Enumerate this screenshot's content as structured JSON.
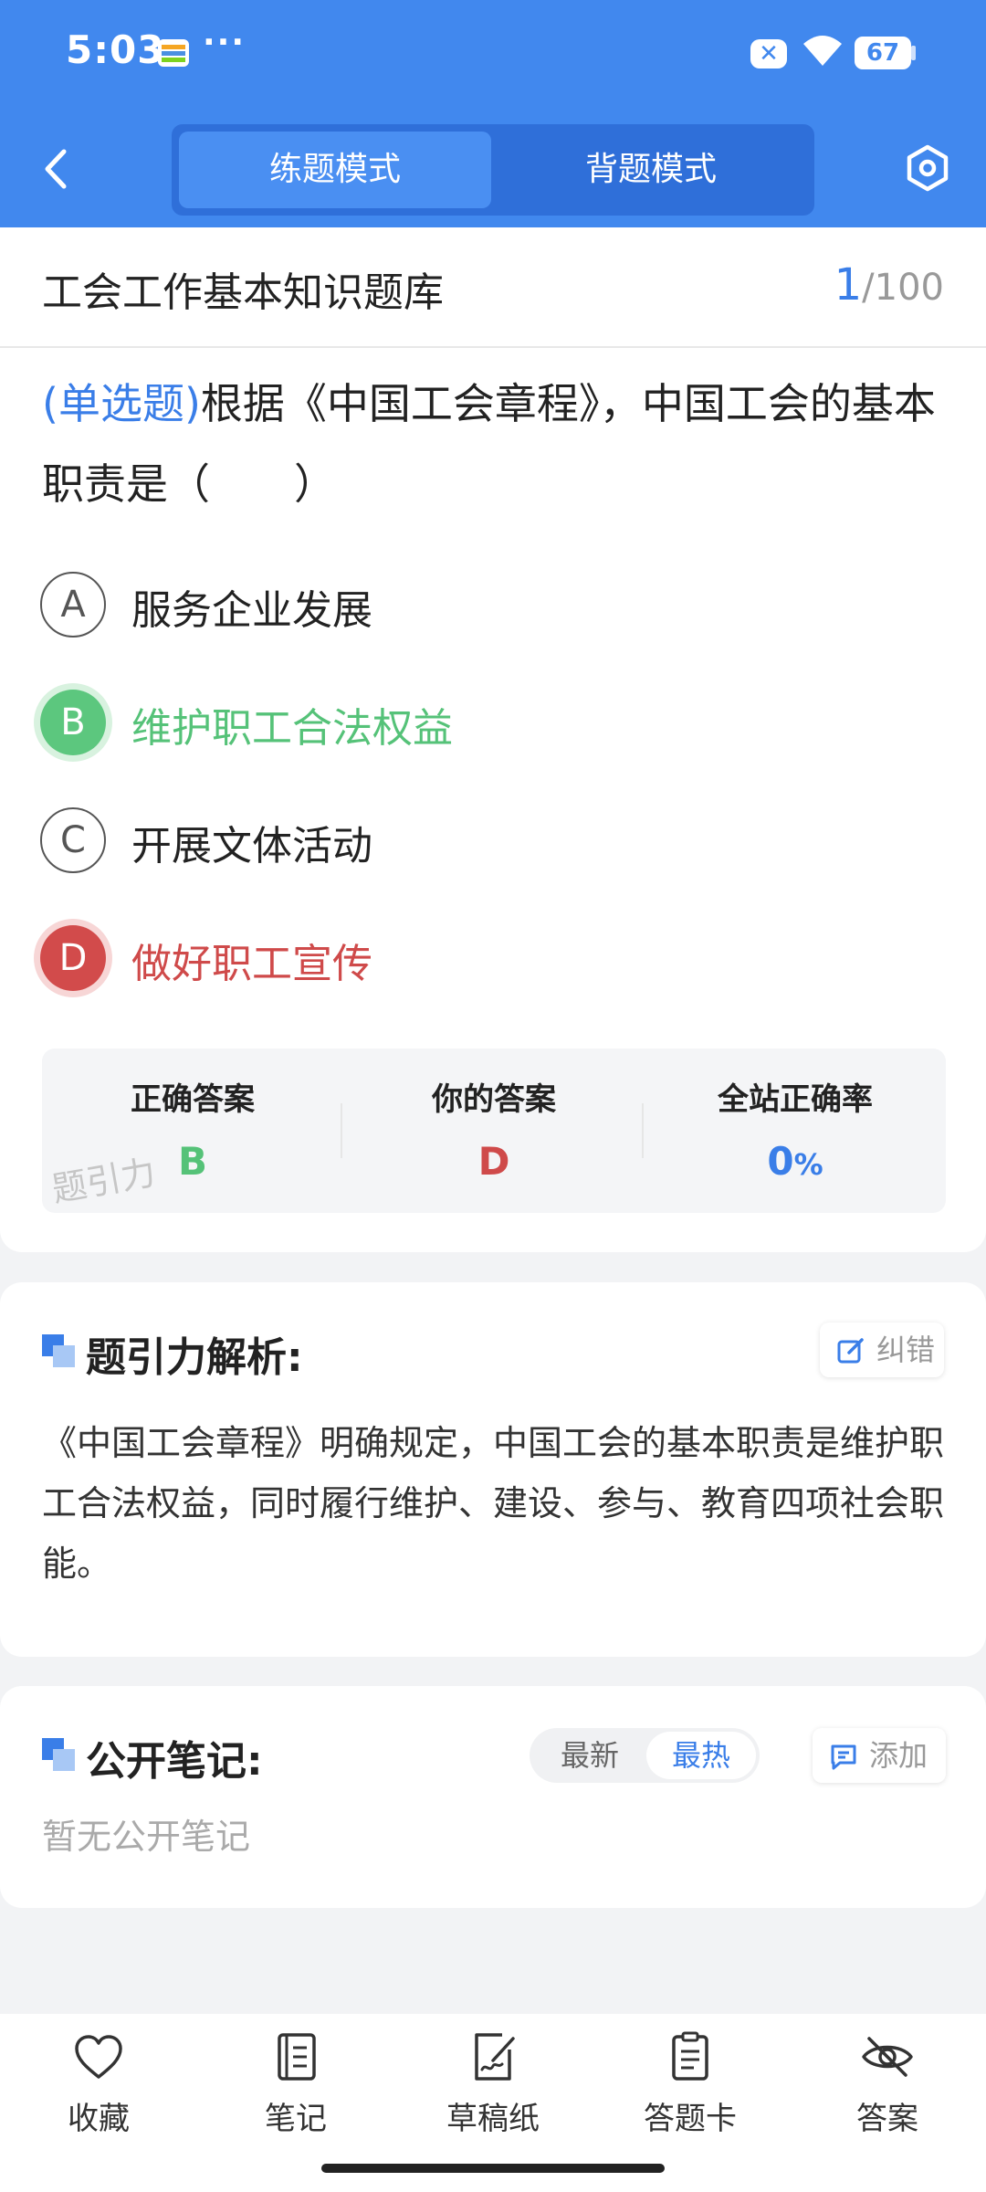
{
  "status_bar": {
    "time": "5:03",
    "more": "···",
    "x_badge": "✕",
    "battery": "67"
  },
  "header": {
    "tabs": [
      {
        "label": "练题模式",
        "active": true
      },
      {
        "label": "背题模式",
        "active": false
      }
    ]
  },
  "question_bank": {
    "title": "工会工作基本知识题库",
    "current": "1",
    "total": "/100"
  },
  "question": {
    "type": "(单选题)",
    "text": "根据《中国工会章程》，中国工会的基本职责是（　　）",
    "options": [
      {
        "letter": "A",
        "text": "服务企业发展",
        "state": "normal"
      },
      {
        "letter": "B",
        "text": "维护职工合法权益",
        "state": "correct"
      },
      {
        "letter": "C",
        "text": "开展文体活动",
        "state": "normal"
      },
      {
        "letter": "D",
        "text": "做好职工宣传",
        "state": "wrong"
      }
    ]
  },
  "answer_summary": {
    "correct_label": "正确答案",
    "correct_value": "B",
    "yours_label": "你的答案",
    "yours_value": "D",
    "rate_label": "全站正确率",
    "rate_value": "0",
    "rate_unit": "%",
    "watermark": "题引力"
  },
  "analysis": {
    "title": "题引力解析:",
    "report_button": "纠错",
    "text": "《中国工会章程》明确规定，中国工会的基本职责是维护职工合法权益，同时履行维护、建设、参与、教育四项社会职能。"
  },
  "notes": {
    "title": "公开笔记:",
    "sort_options": [
      "最新",
      "最热"
    ],
    "sort_active": "最热",
    "add_button": "添加",
    "empty_text": "暂无公开笔记"
  },
  "bottom_nav": [
    {
      "label": "收藏",
      "icon": "heart-icon"
    },
    {
      "label": "笔记",
      "icon": "notebook-icon"
    },
    {
      "label": "草稿纸",
      "icon": "draft-icon"
    },
    {
      "label": "答题卡",
      "icon": "answer-card-icon"
    },
    {
      "label": "答案",
      "icon": "eye-off-icon"
    }
  ],
  "colors": {
    "header_blue": "#4188ee",
    "accent_blue": "#3a7ee8",
    "correct_green": "#55c278",
    "wrong_red": "#cf4a4a"
  }
}
